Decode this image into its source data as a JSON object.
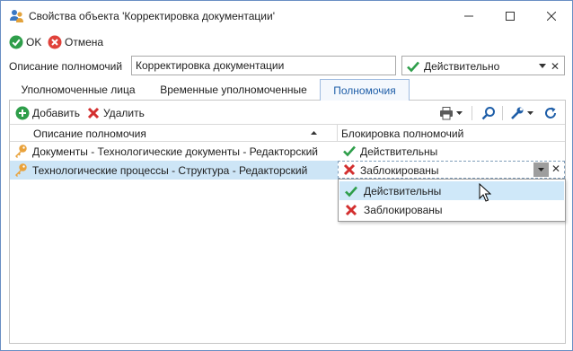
{
  "window": {
    "title": "Свойства объекта 'Корректировка документации'",
    "icons": {
      "app": "users-icon",
      "minimize": "minimize-icon",
      "maximize": "maximize-icon",
      "close": "close-icon"
    }
  },
  "toolbar": {
    "ok_label": "OK",
    "cancel_label": "Отмена"
  },
  "form": {
    "description_label": "Описание полномочий",
    "description_value": "Корректировка документации",
    "status_value": "Действительно"
  },
  "tabs": [
    {
      "label": "Уполномоченные лица",
      "active": false
    },
    {
      "label": "Временные уполномоченные",
      "active": false
    },
    {
      "label": "Полномочия",
      "active": true
    }
  ],
  "panel_toolbar": {
    "add_label": "Добавить",
    "delete_label": "Удалить",
    "icons": [
      "printer-icon",
      "search-icon",
      "wrench-icon",
      "refresh-icon"
    ]
  },
  "grid": {
    "columns": [
      "Описание полномочия",
      "Блокировка полномочий"
    ],
    "rows": [
      {
        "description": "Документы - Технологические документы - Редакторский",
        "status": "Действительны",
        "status_kind": "valid",
        "selected": false
      },
      {
        "description": "Технологические процессы - Структура - Редакторский",
        "status": "Заблокированы",
        "status_kind": "blocked",
        "selected": true
      }
    ]
  },
  "dropdown": {
    "options": [
      {
        "label": "Действительны",
        "kind": "valid",
        "hover": true
      },
      {
        "label": "Заблокированы",
        "kind": "blocked",
        "hover": false
      }
    ]
  },
  "colors": {
    "accent": "#1e5ea8",
    "valid_green": "#2e9e4a",
    "blocked_red": "#d32f2f",
    "selection": "#cde5f6"
  }
}
